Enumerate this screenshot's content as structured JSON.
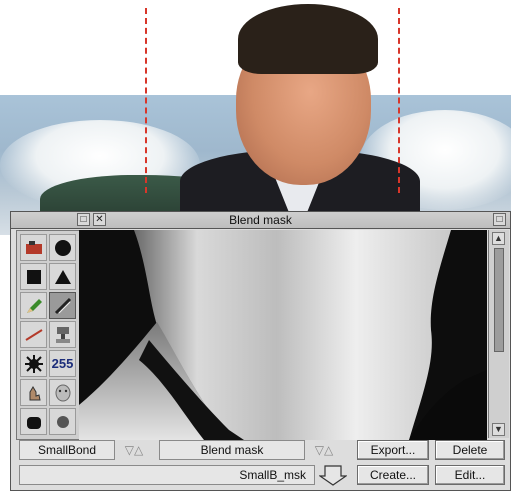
{
  "window": {
    "title": "Blend mask"
  },
  "toolbox": {
    "tools": [
      {
        "icon": "paint-spray-icon"
      },
      {
        "icon": "filled-circle-icon"
      },
      {
        "icon": "filled-square-icon"
      },
      {
        "icon": "filled-triangle-icon"
      },
      {
        "icon": "pencil-icon"
      },
      {
        "icon": "brush-icon"
      },
      {
        "icon": "line-icon"
      },
      {
        "icon": "stamp-icon"
      },
      {
        "icon": "splat-icon"
      },
      {
        "icon": "value-display",
        "label": "255"
      },
      {
        "icon": "smudge-icon"
      },
      {
        "icon": "face-icon"
      }
    ]
  },
  "controls": {
    "source_image": "SmallBond",
    "mask_name": "Blend mask",
    "mask_file": "SmallB_msk",
    "export_label": "Export...",
    "delete_label": "Delete",
    "create_label": "Create...",
    "edit_label": "Edit...",
    "updown_glyph": "▽△"
  },
  "colors": {
    "titlebar": "#c8c8c8",
    "window_bg": "#dddddd",
    "guide_line": "#d8362a"
  }
}
